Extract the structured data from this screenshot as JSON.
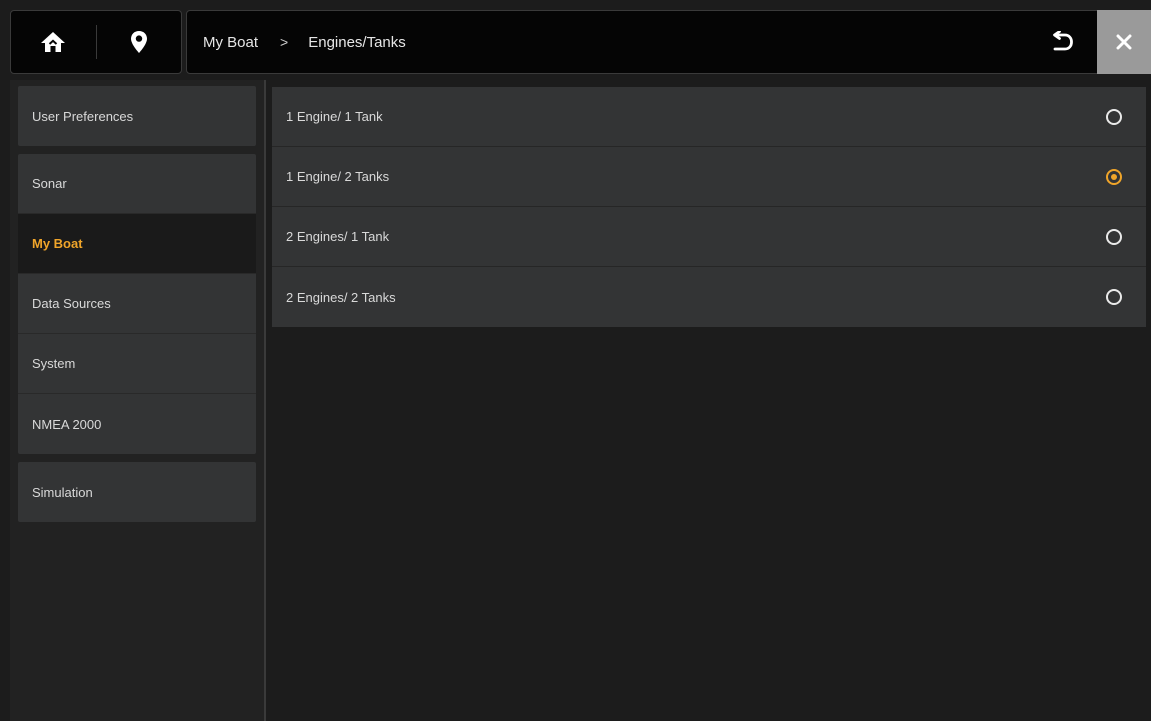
{
  "header": {
    "breadcrumb": [
      "My Boat",
      "Engines/Tanks"
    ],
    "crumb_separator": ">",
    "icons": {
      "home": "home-icon",
      "location": "location-pin-icon",
      "back": "back-arrow-icon",
      "close": "close-icon"
    }
  },
  "sidebar": {
    "items": [
      {
        "label": "User Preferences",
        "active": false
      },
      {
        "label": "Sonar",
        "active": false
      },
      {
        "label": "My Boat",
        "active": true
      },
      {
        "label": "Data Sources",
        "active": false
      },
      {
        "label": "System",
        "active": false
      },
      {
        "label": "NMEA 2000",
        "active": false
      },
      {
        "label": "Simulation",
        "active": false
      }
    ]
  },
  "options": {
    "items": [
      {
        "label": "1 Engine/ 1 Tank",
        "selected": false
      },
      {
        "label": "1 Engine/ 2 Tanks",
        "selected": true
      },
      {
        "label": "2 Engines/ 1 Tank",
        "selected": false
      },
      {
        "label": "2 Engines/ 2 Tanks",
        "selected": false
      }
    ]
  },
  "colors": {
    "accent": "#f0a52a",
    "background": "#1c1c1c",
    "panel": "#333435",
    "close_button": "#9a9a9a"
  }
}
